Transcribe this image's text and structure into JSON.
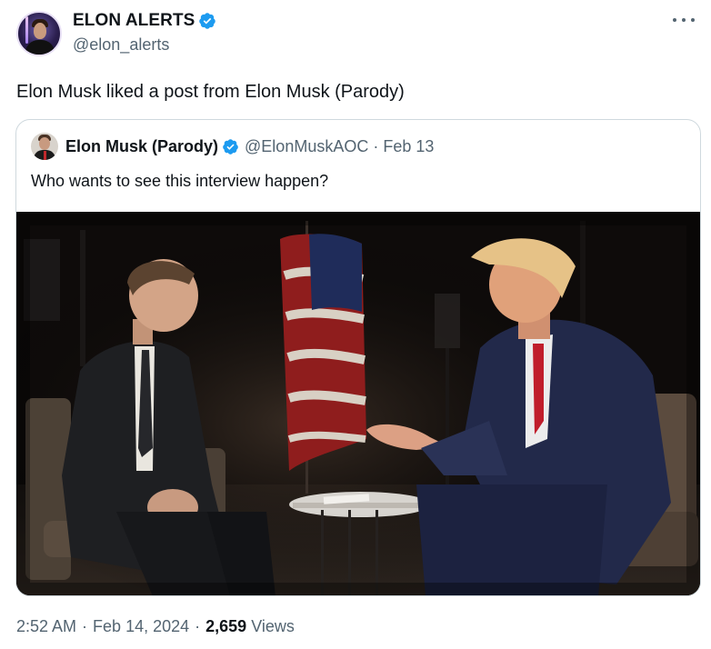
{
  "author": {
    "display_name": "ELON ALERTS",
    "handle": "@elon_alerts",
    "verified_color": "#1d9bf0"
  },
  "tweet": {
    "text": "Elon Musk liked a post from Elon Musk (Parody)"
  },
  "quoted_tweet": {
    "display_name": "Elon Musk (Parody)",
    "handle": "@ElonMuskAOC",
    "separator": "·",
    "date": "Feb 13",
    "text": "Who wants to see this interview happen?"
  },
  "footer": {
    "time": "2:52 AM",
    "separator": "·",
    "date": "Feb 14, 2024",
    "views_count": "2,659",
    "views_label": "Views"
  },
  "icons": {
    "more": "more-dots-icon",
    "verified": "verified-badge-icon"
  }
}
